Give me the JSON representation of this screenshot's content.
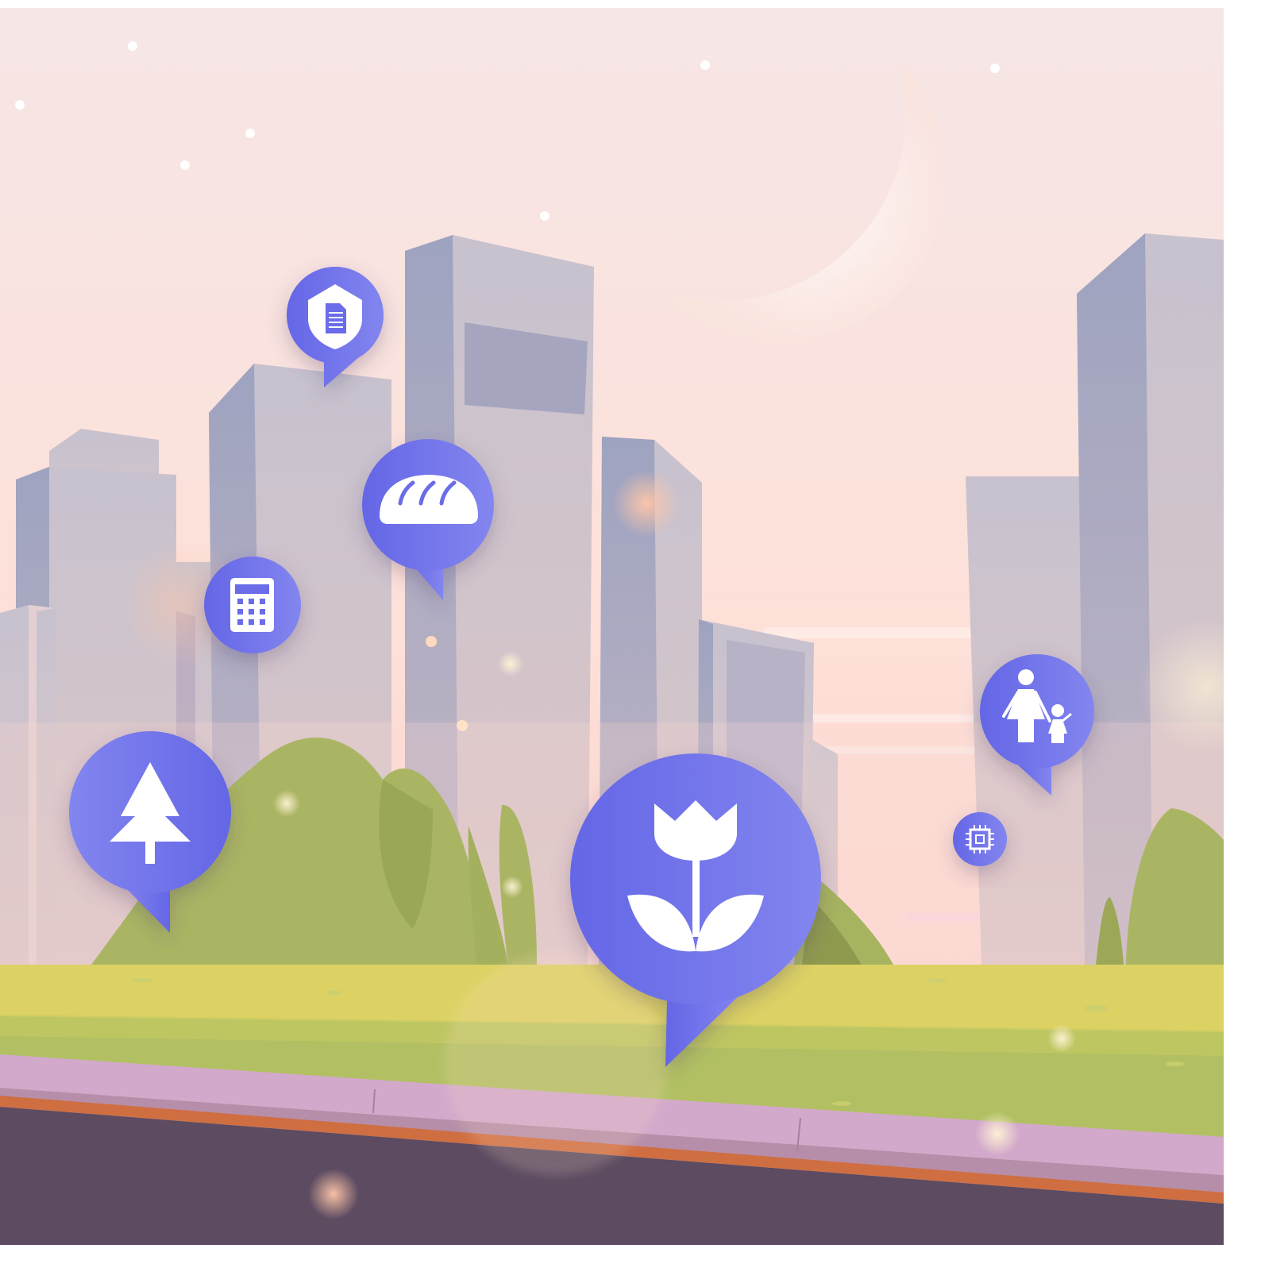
{
  "scene": {
    "description_tags": [
      "city-skyline",
      "crescent-moon",
      "stars",
      "bushes",
      "grass",
      "sidewalk",
      "road"
    ],
    "colors": {
      "sky_top": "#f6e6e6",
      "sky_bottom": "#fcd9d3",
      "building_light": "#cdc6d0",
      "building_shade": "#9fa3c0",
      "bush": "#aab563",
      "bush_dark": "#8f9a4f",
      "grass_light": "#dcd264",
      "grass": "#b2c063",
      "sidewalk": "#d2a9cb",
      "curb": "#b68ea9",
      "road": "#5c4b61",
      "road_stripe": "#cf6e41",
      "pin_blue": "#6a6ce8",
      "pin_blue_light": "#8183ee"
    }
  },
  "pins": [
    {
      "icon": "shield-document-icon"
    },
    {
      "icon": "bread-icon"
    },
    {
      "icon": "calculator-icon"
    },
    {
      "icon": "tree-icon"
    },
    {
      "icon": "tulip-icon"
    },
    {
      "icon": "mother-child-icon"
    },
    {
      "icon": "chip-icon"
    }
  ]
}
